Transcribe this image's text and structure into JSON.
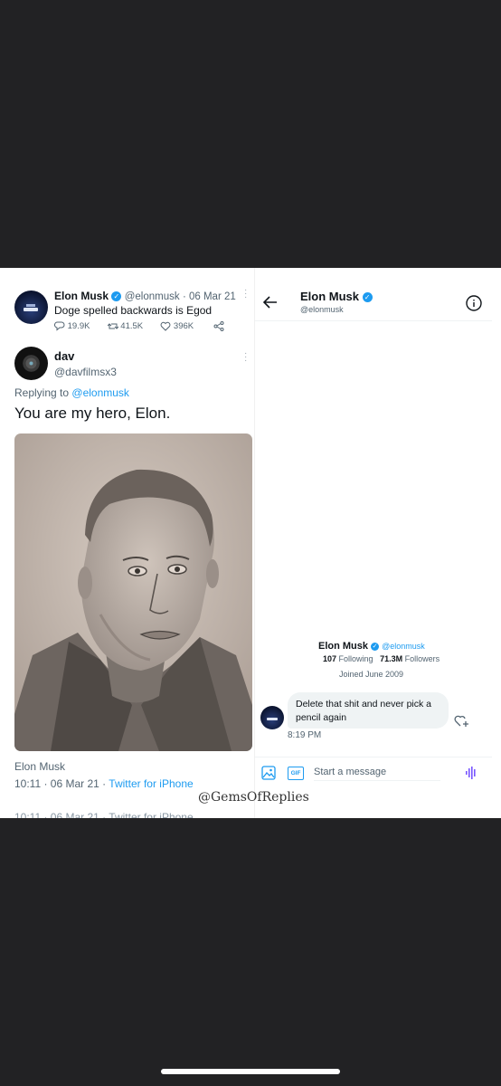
{
  "tweet": {
    "author_name": "Elon Musk",
    "author_handle": "@elonmusk",
    "date": "· 06 Mar 21",
    "text": "Doge spelled backwards is Egod",
    "replies": "19.9K",
    "retweets": "41.5K",
    "likes": "396K"
  },
  "reply": {
    "author_name": "dav",
    "author_handle": "@davfilmsx3",
    "replying_prefix": "Replying to",
    "replying_to": "@elonmusk",
    "text": "You are my hero, Elon."
  },
  "footer": {
    "name": "Elon Musk",
    "time": "10:11 · 06 Mar 21 ·",
    "source": "Twitter for iPhone",
    "cut_off_text": "10:11 · 06 Mar 21 · Twitter for iPhone"
  },
  "watermark": "@GemsOfReplies",
  "dm": {
    "header_name": "Elon Musk",
    "header_handle": "@elonmusk",
    "profile_name": "Elon Musk",
    "profile_handle": "@elonmusk",
    "following_count": "107",
    "following_label": "Following",
    "followers_count": "71.3M",
    "followers_label": "Followers",
    "joined": "Joined June 2009",
    "message_line1": "Delete that shit and never pick a",
    "message_line2": "pencil again",
    "message_time": "8:19 PM",
    "gif_label": "GIF",
    "input_placeholder": "Start a message"
  },
  "colors": {
    "accent": "#1d9bf0",
    "background": "#222224",
    "card": "#ffffff",
    "bubble": "#eff3f4"
  }
}
